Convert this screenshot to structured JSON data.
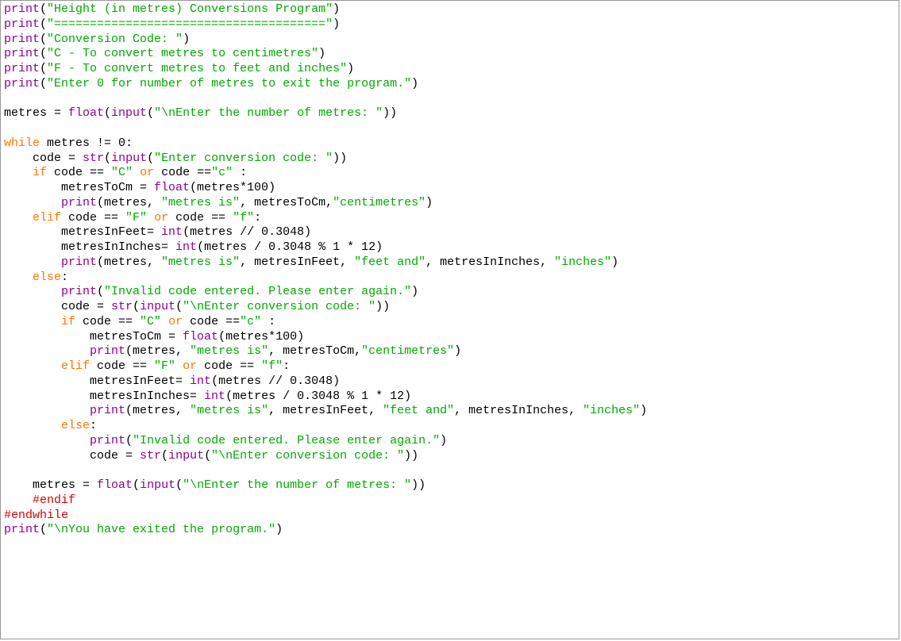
{
  "lines": [
    [
      {
        "c": "fn",
        "t": "print"
      },
      {
        "c": "op",
        "t": "("
      },
      {
        "c": "str",
        "t": "\"Height (in metres) Conversions Program\""
      },
      {
        "c": "op",
        "t": ")"
      }
    ],
    [
      {
        "c": "fn",
        "t": "print"
      },
      {
        "c": "op",
        "t": "("
      },
      {
        "c": "str",
        "t": "\"======================================\""
      },
      {
        "c": "op",
        "t": ")"
      }
    ],
    [
      {
        "c": "fn",
        "t": "print"
      },
      {
        "c": "op",
        "t": "("
      },
      {
        "c": "str",
        "t": "\"Conversion Code: \""
      },
      {
        "c": "op",
        "t": ")"
      }
    ],
    [
      {
        "c": "fn",
        "t": "print"
      },
      {
        "c": "op",
        "t": "("
      },
      {
        "c": "str",
        "t": "\"C - To convert metres to centimetres\""
      },
      {
        "c": "op",
        "t": ")"
      }
    ],
    [
      {
        "c": "fn",
        "t": "print"
      },
      {
        "c": "op",
        "t": "("
      },
      {
        "c": "str",
        "t": "\"F - To convert metres to feet and inches\""
      },
      {
        "c": "op",
        "t": ")"
      }
    ],
    [
      {
        "c": "fn",
        "t": "print"
      },
      {
        "c": "op",
        "t": "("
      },
      {
        "c": "str",
        "t": "\"Enter 0 for number of metres to exit the program.\""
      },
      {
        "c": "op",
        "t": ")"
      }
    ],
    [],
    [
      {
        "c": "id",
        "t": "metres = "
      },
      {
        "c": "fn",
        "t": "float"
      },
      {
        "c": "op",
        "t": "("
      },
      {
        "c": "fn",
        "t": "input"
      },
      {
        "c": "op",
        "t": "("
      },
      {
        "c": "str",
        "t": "\"\\nEnter the number of metres: \""
      },
      {
        "c": "op",
        "t": "))"
      }
    ],
    [],
    [
      {
        "c": "kw",
        "t": "while"
      },
      {
        "c": "id",
        "t": " metres != 0:"
      }
    ],
    [
      {
        "c": "id",
        "t": "    code = "
      },
      {
        "c": "fn",
        "t": "str"
      },
      {
        "c": "op",
        "t": "("
      },
      {
        "c": "fn",
        "t": "input"
      },
      {
        "c": "op",
        "t": "("
      },
      {
        "c": "str",
        "t": "\"Enter conversion code: \""
      },
      {
        "c": "op",
        "t": "))"
      }
    ],
    [
      {
        "c": "id",
        "t": "    "
      },
      {
        "c": "kw",
        "t": "if"
      },
      {
        "c": "id",
        "t": " code == "
      },
      {
        "c": "str",
        "t": "\"C\""
      },
      {
        "c": "id",
        "t": " "
      },
      {
        "c": "kw",
        "t": "or"
      },
      {
        "c": "id",
        "t": " code =="
      },
      {
        "c": "str",
        "t": "\"c\""
      },
      {
        "c": "id",
        "t": " :"
      }
    ],
    [
      {
        "c": "id",
        "t": "        metresToCm = "
      },
      {
        "c": "fn",
        "t": "float"
      },
      {
        "c": "op",
        "t": "(metres*100)"
      }
    ],
    [
      {
        "c": "id",
        "t": "        "
      },
      {
        "c": "fn",
        "t": "print"
      },
      {
        "c": "op",
        "t": "(metres, "
      },
      {
        "c": "str",
        "t": "\"metres is\""
      },
      {
        "c": "op",
        "t": ", metresToCm,"
      },
      {
        "c": "str",
        "t": "\"centimetres\""
      },
      {
        "c": "op",
        "t": ")"
      }
    ],
    [
      {
        "c": "id",
        "t": "    "
      },
      {
        "c": "kw",
        "t": "elif"
      },
      {
        "c": "id",
        "t": " code == "
      },
      {
        "c": "str",
        "t": "\"F\""
      },
      {
        "c": "id",
        "t": " "
      },
      {
        "c": "kw",
        "t": "or"
      },
      {
        "c": "id",
        "t": " code == "
      },
      {
        "c": "str",
        "t": "\"f\""
      },
      {
        "c": "op",
        "t": ":"
      }
    ],
    [
      {
        "c": "id",
        "t": "        metresInFeet= "
      },
      {
        "c": "fn",
        "t": "int"
      },
      {
        "c": "op",
        "t": "(metres // 0.3048)"
      }
    ],
    [
      {
        "c": "id",
        "t": "        metresInInches= "
      },
      {
        "c": "fn",
        "t": "int"
      },
      {
        "c": "op",
        "t": "(metres / 0.3048 % 1 * 12)"
      }
    ],
    [
      {
        "c": "id",
        "t": "        "
      },
      {
        "c": "fn",
        "t": "print"
      },
      {
        "c": "op",
        "t": "(metres, "
      },
      {
        "c": "str",
        "t": "\"metres is\""
      },
      {
        "c": "op",
        "t": ", metresInFeet, "
      },
      {
        "c": "str",
        "t": "\"feet and\""
      },
      {
        "c": "op",
        "t": ", metresInInches, "
      },
      {
        "c": "str",
        "t": "\"inches\""
      },
      {
        "c": "op",
        "t": ")"
      }
    ],
    [
      {
        "c": "id",
        "t": "    "
      },
      {
        "c": "kw",
        "t": "else"
      },
      {
        "c": "op",
        "t": ":"
      }
    ],
    [
      {
        "c": "id",
        "t": "        "
      },
      {
        "c": "fn",
        "t": "print"
      },
      {
        "c": "op",
        "t": "("
      },
      {
        "c": "str",
        "t": "\"Invalid code entered. Please enter again.\""
      },
      {
        "c": "op",
        "t": ")"
      }
    ],
    [
      {
        "c": "id",
        "t": "        code = "
      },
      {
        "c": "fn",
        "t": "str"
      },
      {
        "c": "op",
        "t": "("
      },
      {
        "c": "fn",
        "t": "input"
      },
      {
        "c": "op",
        "t": "("
      },
      {
        "c": "str",
        "t": "\"\\nEnter conversion code: \""
      },
      {
        "c": "op",
        "t": "))"
      }
    ],
    [
      {
        "c": "id",
        "t": "        "
      },
      {
        "c": "kw",
        "t": "if"
      },
      {
        "c": "id",
        "t": " code == "
      },
      {
        "c": "str",
        "t": "\"C\""
      },
      {
        "c": "id",
        "t": " "
      },
      {
        "c": "kw",
        "t": "or"
      },
      {
        "c": "id",
        "t": " code =="
      },
      {
        "c": "str",
        "t": "\"c\""
      },
      {
        "c": "id",
        "t": " :"
      }
    ],
    [
      {
        "c": "id",
        "t": "            metresToCm = "
      },
      {
        "c": "fn",
        "t": "float"
      },
      {
        "c": "op",
        "t": "(metres*100)"
      }
    ],
    [
      {
        "c": "id",
        "t": "            "
      },
      {
        "c": "fn",
        "t": "print"
      },
      {
        "c": "op",
        "t": "(metres, "
      },
      {
        "c": "str",
        "t": "\"metres is\""
      },
      {
        "c": "op",
        "t": ", metresToCm,"
      },
      {
        "c": "str",
        "t": "\"centimetres\""
      },
      {
        "c": "op",
        "t": ")"
      }
    ],
    [
      {
        "c": "id",
        "t": "        "
      },
      {
        "c": "kw",
        "t": "elif"
      },
      {
        "c": "id",
        "t": " code == "
      },
      {
        "c": "str",
        "t": "\"F\""
      },
      {
        "c": "id",
        "t": " "
      },
      {
        "c": "kw",
        "t": "or"
      },
      {
        "c": "id",
        "t": " code == "
      },
      {
        "c": "str",
        "t": "\"f\""
      },
      {
        "c": "op",
        "t": ":"
      }
    ],
    [
      {
        "c": "id",
        "t": "            metresInFeet= "
      },
      {
        "c": "fn",
        "t": "int"
      },
      {
        "c": "op",
        "t": "(metres // 0.3048)"
      }
    ],
    [
      {
        "c": "id",
        "t": "            metresInInches= "
      },
      {
        "c": "fn",
        "t": "int"
      },
      {
        "c": "op",
        "t": "(metres / 0.3048 % 1 * 12)"
      }
    ],
    [
      {
        "c": "id",
        "t": "            "
      },
      {
        "c": "fn",
        "t": "print"
      },
      {
        "c": "op",
        "t": "(metres, "
      },
      {
        "c": "str",
        "t": "\"metres is\""
      },
      {
        "c": "op",
        "t": ", metresInFeet, "
      },
      {
        "c": "str",
        "t": "\"feet and\""
      },
      {
        "c": "op",
        "t": ", metresInInches, "
      },
      {
        "c": "str",
        "t": "\"inches\""
      },
      {
        "c": "op",
        "t": ")"
      }
    ],
    [
      {
        "c": "id",
        "t": "        "
      },
      {
        "c": "kw",
        "t": "else"
      },
      {
        "c": "op",
        "t": ":"
      }
    ],
    [
      {
        "c": "id",
        "t": "            "
      },
      {
        "c": "fn",
        "t": "print"
      },
      {
        "c": "op",
        "t": "("
      },
      {
        "c": "str",
        "t": "\"Invalid code entered. Please enter again.\""
      },
      {
        "c": "op",
        "t": ")"
      }
    ],
    [
      {
        "c": "id",
        "t": "            code = "
      },
      {
        "c": "fn",
        "t": "str"
      },
      {
        "c": "op",
        "t": "("
      },
      {
        "c": "fn",
        "t": "input"
      },
      {
        "c": "op",
        "t": "("
      },
      {
        "c": "str",
        "t": "\"\\nEnter conversion code: \""
      },
      {
        "c": "op",
        "t": "))"
      }
    ],
    [],
    [
      {
        "c": "id",
        "t": "    metres = "
      },
      {
        "c": "fn",
        "t": "float"
      },
      {
        "c": "op",
        "t": "("
      },
      {
        "c": "fn",
        "t": "input"
      },
      {
        "c": "op",
        "t": "("
      },
      {
        "c": "str",
        "t": "\"\\nEnter the number of metres: \""
      },
      {
        "c": "op",
        "t": "))"
      }
    ],
    [
      {
        "c": "id",
        "t": "    "
      },
      {
        "c": "cmt",
        "t": "#endif"
      }
    ],
    [
      {
        "c": "cmt",
        "t": "#endwhile"
      }
    ],
    [
      {
        "c": "fn",
        "t": "print"
      },
      {
        "c": "op",
        "t": "("
      },
      {
        "c": "str",
        "t": "\"\\nYou have exited the program.\""
      },
      {
        "c": "op",
        "t": ")"
      }
    ]
  ]
}
